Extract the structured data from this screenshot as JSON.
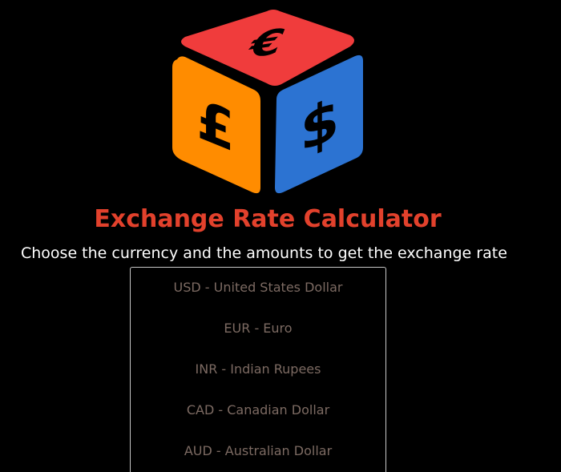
{
  "header": {
    "title": "Exchange Rate Calculator",
    "subtitle": "Choose the currency and the amounts to get the exchange rate"
  },
  "logo": {
    "symbols": [
      "€",
      "£",
      "$"
    ],
    "colors": {
      "top": "#f03c3c",
      "left": "#ff8c00",
      "right": "#2c73d2"
    }
  },
  "currency_select": {
    "options": [
      "USD - United States Dollar",
      "EUR - Euro",
      "INR - Indian Rupees",
      "CAD - Canadian Dollar",
      "AUD - Australian Dollar"
    ]
  },
  "theme": {
    "background": "#000000",
    "title_color": "#e2412c",
    "subtitle_color": "#ffffff",
    "option_color": "#7c6a62"
  }
}
